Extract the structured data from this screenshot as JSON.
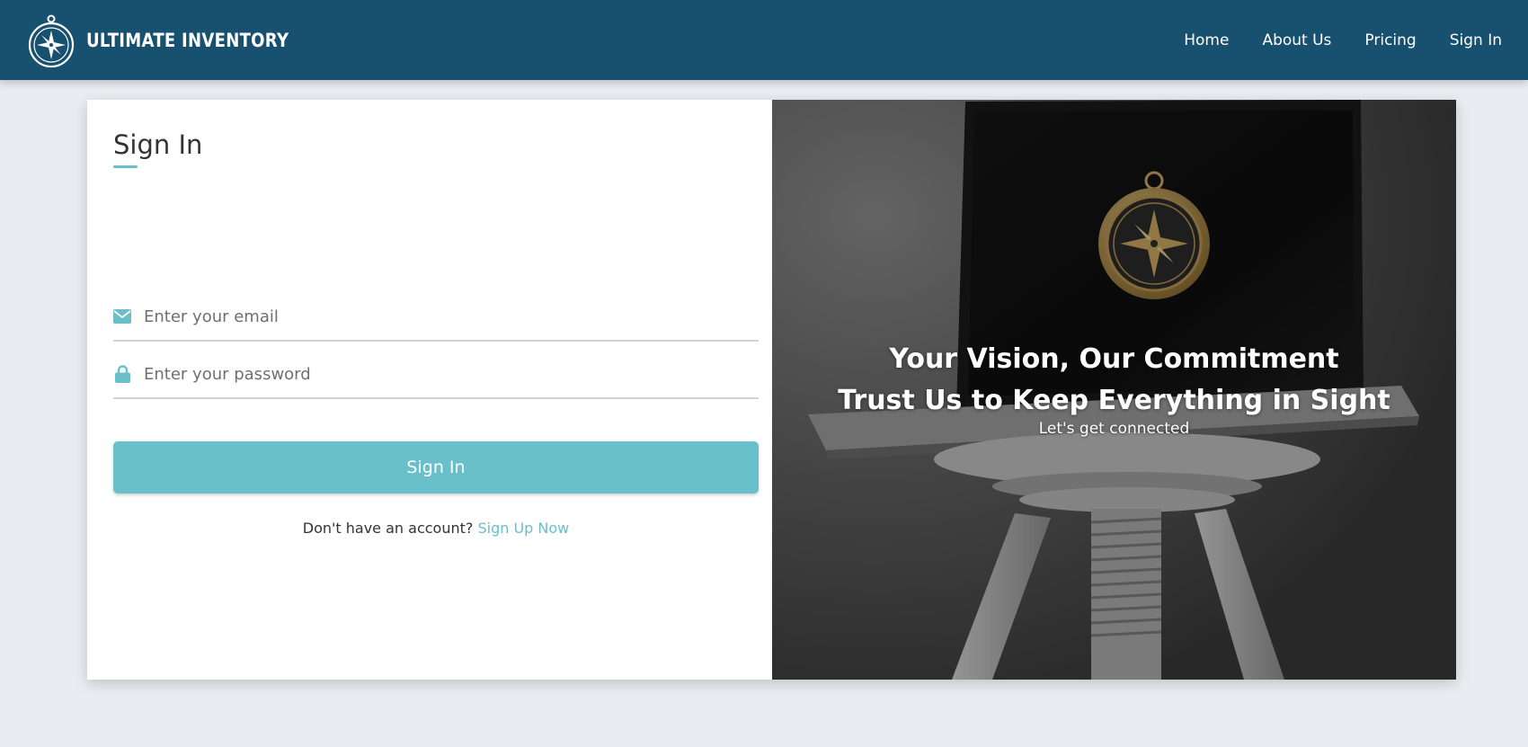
{
  "brand": {
    "name": "ULTIMATE INVENTORY",
    "logo_icon": "compass-icon"
  },
  "nav": {
    "items": [
      {
        "label": "Home"
      },
      {
        "label": "About Us"
      },
      {
        "label": "Pricing"
      },
      {
        "label": "Sign In"
      }
    ]
  },
  "signin": {
    "title": "Sign In",
    "email": {
      "placeholder": "Enter your email",
      "value": "",
      "icon": "envelope-icon"
    },
    "password": {
      "placeholder": "Enter your password",
      "value": "",
      "icon": "lock-icon"
    },
    "submit_label": "Sign In",
    "prompt": "Don't have an account?",
    "signup_link": "Sign Up Now"
  },
  "hero": {
    "headline_1": "Your Vision, Our Commitment",
    "headline_2": "Trust Us to Keep Everything in Sight",
    "tagline": "Let's get connected",
    "image": "laptop-with-compass-logo-on-stool"
  },
  "colors": {
    "navbar": "#185070",
    "accent": "#69bfca",
    "background": "#e9edf1",
    "text": "#333333"
  }
}
